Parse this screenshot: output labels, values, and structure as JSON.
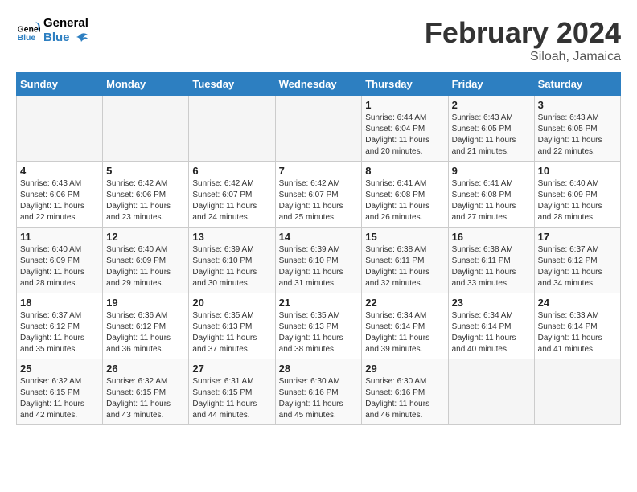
{
  "header": {
    "logo_line1": "General",
    "logo_line2": "Blue",
    "title": "February 2024",
    "subtitle": "Siloah, Jamaica"
  },
  "weekdays": [
    "Sunday",
    "Monday",
    "Tuesday",
    "Wednesday",
    "Thursday",
    "Friday",
    "Saturday"
  ],
  "weeks": [
    [
      {
        "day": "",
        "info": ""
      },
      {
        "day": "",
        "info": ""
      },
      {
        "day": "",
        "info": ""
      },
      {
        "day": "",
        "info": ""
      },
      {
        "day": "1",
        "info": "Sunrise: 6:44 AM\nSunset: 6:04 PM\nDaylight: 11 hours\nand 20 minutes."
      },
      {
        "day": "2",
        "info": "Sunrise: 6:43 AM\nSunset: 6:05 PM\nDaylight: 11 hours\nand 21 minutes."
      },
      {
        "day": "3",
        "info": "Sunrise: 6:43 AM\nSunset: 6:05 PM\nDaylight: 11 hours\nand 22 minutes."
      }
    ],
    [
      {
        "day": "4",
        "info": "Sunrise: 6:43 AM\nSunset: 6:06 PM\nDaylight: 11 hours\nand 22 minutes."
      },
      {
        "day": "5",
        "info": "Sunrise: 6:42 AM\nSunset: 6:06 PM\nDaylight: 11 hours\nand 23 minutes."
      },
      {
        "day": "6",
        "info": "Sunrise: 6:42 AM\nSunset: 6:07 PM\nDaylight: 11 hours\nand 24 minutes."
      },
      {
        "day": "7",
        "info": "Sunrise: 6:42 AM\nSunset: 6:07 PM\nDaylight: 11 hours\nand 25 minutes."
      },
      {
        "day": "8",
        "info": "Sunrise: 6:41 AM\nSunset: 6:08 PM\nDaylight: 11 hours\nand 26 minutes."
      },
      {
        "day": "9",
        "info": "Sunrise: 6:41 AM\nSunset: 6:08 PM\nDaylight: 11 hours\nand 27 minutes."
      },
      {
        "day": "10",
        "info": "Sunrise: 6:40 AM\nSunset: 6:09 PM\nDaylight: 11 hours\nand 28 minutes."
      }
    ],
    [
      {
        "day": "11",
        "info": "Sunrise: 6:40 AM\nSunset: 6:09 PM\nDaylight: 11 hours\nand 28 minutes."
      },
      {
        "day": "12",
        "info": "Sunrise: 6:40 AM\nSunset: 6:09 PM\nDaylight: 11 hours\nand 29 minutes."
      },
      {
        "day": "13",
        "info": "Sunrise: 6:39 AM\nSunset: 6:10 PM\nDaylight: 11 hours\nand 30 minutes."
      },
      {
        "day": "14",
        "info": "Sunrise: 6:39 AM\nSunset: 6:10 PM\nDaylight: 11 hours\nand 31 minutes."
      },
      {
        "day": "15",
        "info": "Sunrise: 6:38 AM\nSunset: 6:11 PM\nDaylight: 11 hours\nand 32 minutes."
      },
      {
        "day": "16",
        "info": "Sunrise: 6:38 AM\nSunset: 6:11 PM\nDaylight: 11 hours\nand 33 minutes."
      },
      {
        "day": "17",
        "info": "Sunrise: 6:37 AM\nSunset: 6:12 PM\nDaylight: 11 hours\nand 34 minutes."
      }
    ],
    [
      {
        "day": "18",
        "info": "Sunrise: 6:37 AM\nSunset: 6:12 PM\nDaylight: 11 hours\nand 35 minutes."
      },
      {
        "day": "19",
        "info": "Sunrise: 6:36 AM\nSunset: 6:12 PM\nDaylight: 11 hours\nand 36 minutes."
      },
      {
        "day": "20",
        "info": "Sunrise: 6:35 AM\nSunset: 6:13 PM\nDaylight: 11 hours\nand 37 minutes."
      },
      {
        "day": "21",
        "info": "Sunrise: 6:35 AM\nSunset: 6:13 PM\nDaylight: 11 hours\nand 38 minutes."
      },
      {
        "day": "22",
        "info": "Sunrise: 6:34 AM\nSunset: 6:14 PM\nDaylight: 11 hours\nand 39 minutes."
      },
      {
        "day": "23",
        "info": "Sunrise: 6:34 AM\nSunset: 6:14 PM\nDaylight: 11 hours\nand 40 minutes."
      },
      {
        "day": "24",
        "info": "Sunrise: 6:33 AM\nSunset: 6:14 PM\nDaylight: 11 hours\nand 41 minutes."
      }
    ],
    [
      {
        "day": "25",
        "info": "Sunrise: 6:32 AM\nSunset: 6:15 PM\nDaylight: 11 hours\nand 42 minutes."
      },
      {
        "day": "26",
        "info": "Sunrise: 6:32 AM\nSunset: 6:15 PM\nDaylight: 11 hours\nand 43 minutes."
      },
      {
        "day": "27",
        "info": "Sunrise: 6:31 AM\nSunset: 6:15 PM\nDaylight: 11 hours\nand 44 minutes."
      },
      {
        "day": "28",
        "info": "Sunrise: 6:30 AM\nSunset: 6:16 PM\nDaylight: 11 hours\nand 45 minutes."
      },
      {
        "day": "29",
        "info": "Sunrise: 6:30 AM\nSunset: 6:16 PM\nDaylight: 11 hours\nand 46 minutes."
      },
      {
        "day": "",
        "info": ""
      },
      {
        "day": "",
        "info": ""
      }
    ]
  ]
}
